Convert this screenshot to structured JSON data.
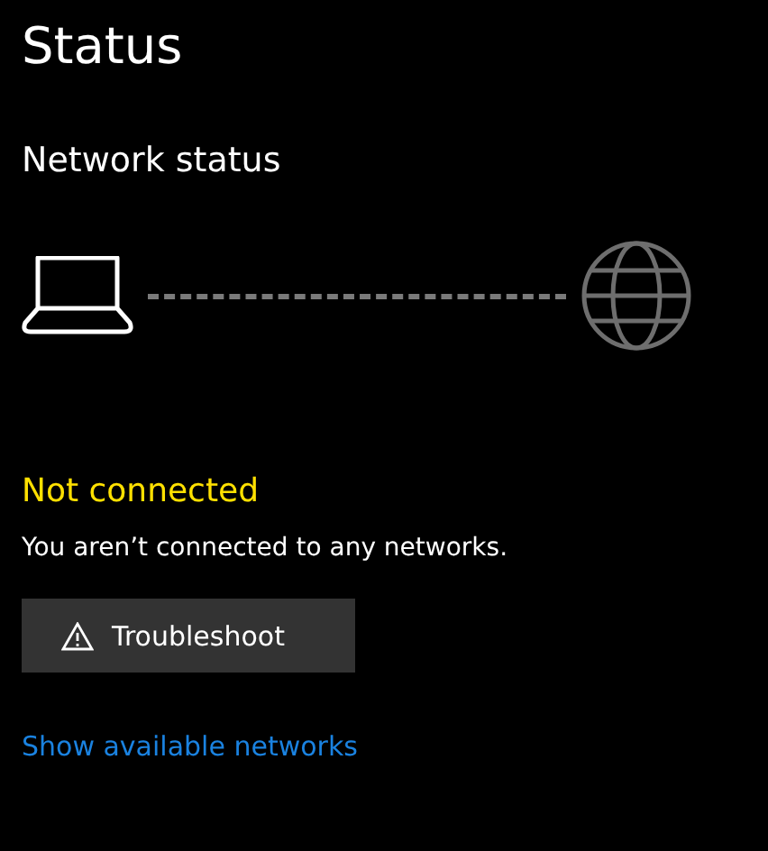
{
  "title": "Status",
  "section": "Network status",
  "status": {
    "text": "Not connected",
    "connected": false
  },
  "message": "You aren’t connected to any networks.",
  "button": "Troubleshoot",
  "link": "Show available networks"
}
